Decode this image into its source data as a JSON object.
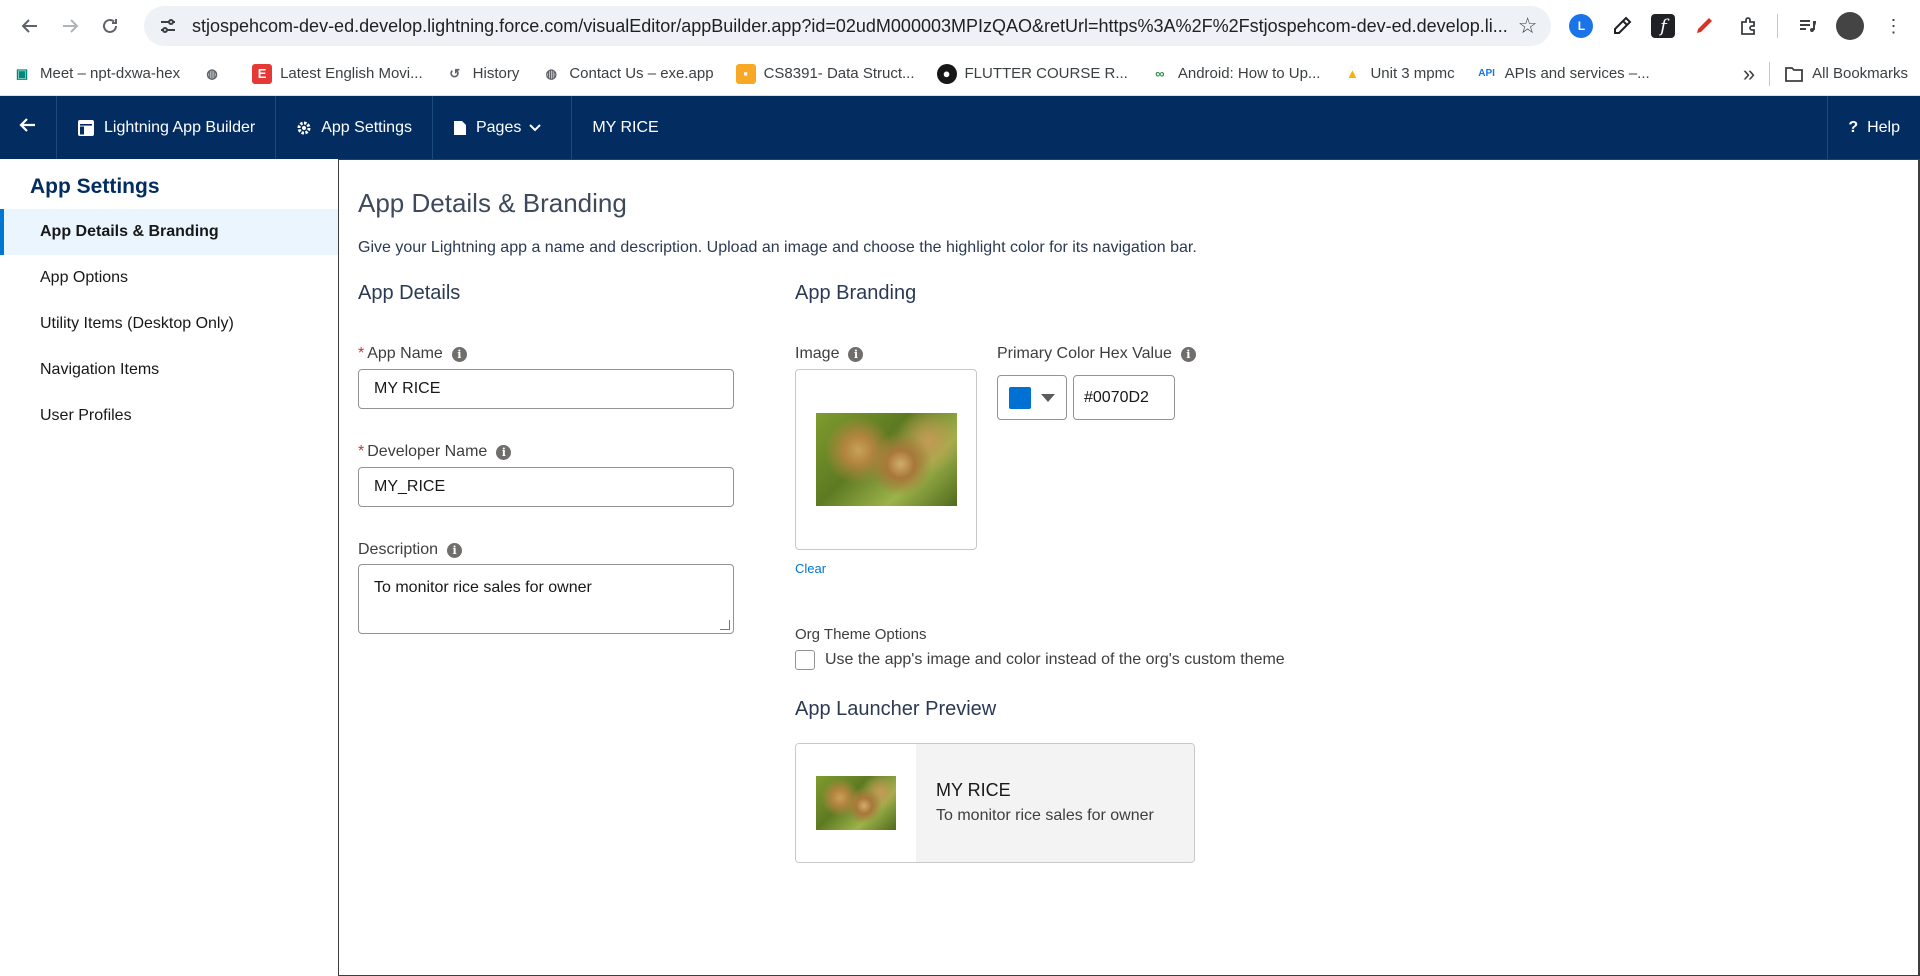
{
  "browser": {
    "url": "stjospehcom-dev-ed.develop.lightning.force.com/visualEditor/appBuilder.app?id=02udM000003MPIzQAO&retUrl=https%3A%2F%2Fstjospehcom-dev-ed.develop.li...",
    "bookmarks": [
      {
        "label": "Meet – npt-dxwa-hex",
        "icon": "meet-icon",
        "color": "#00897b"
      },
      {
        "label": "",
        "icon": "globe-icon",
        "color": "#5f6368"
      },
      {
        "label": "Latest English Movi...",
        "icon": "e-icon",
        "color": "#e53935"
      },
      {
        "label": "History",
        "icon": "history-icon",
        "color": "#5f6368"
      },
      {
        "label": "Contact Us – exe.app",
        "icon": "globe-icon",
        "color": "#5f6368"
      },
      {
        "label": "CS8391- Data Struct...",
        "icon": "classroom-icon",
        "color": "#f9a825"
      },
      {
        "label": "FLUTTER COURSE R...",
        "icon": "github-icon",
        "color": "#181717"
      },
      {
        "label": "Android: How to Up...",
        "icon": "gfg-icon",
        "color": "#2f8d46"
      },
      {
        "label": "Unit 3 mpmc",
        "icon": "drive-icon",
        "color": "#f4b400"
      },
      {
        "label": "APIs and services –...",
        "icon": "api-icon",
        "color": "#1a73e8"
      }
    ],
    "more_label": "»",
    "all_bookmarks": "All Bookmarks"
  },
  "header": {
    "builder_label": "Lightning App Builder",
    "settings_label": "App Settings",
    "pages_label": "Pages",
    "app_title": "MY RICE",
    "help_label": "Help"
  },
  "sidebar": {
    "title": "App Settings",
    "items": [
      {
        "label": "App Details & Branding",
        "active": true
      },
      {
        "label": "App Options"
      },
      {
        "label": "Utility Items (Desktop Only)"
      },
      {
        "label": "Navigation Items"
      },
      {
        "label": "User Profiles"
      }
    ]
  },
  "main": {
    "title": "App Details & Branding",
    "description": "Give your Lightning app a name and description. Upload an image and choose the highlight color for its navigation bar.",
    "details": {
      "section_title": "App Details",
      "app_name_label": "App Name",
      "app_name_value": "MY RICE",
      "dev_name_label": "Developer Name",
      "dev_name_value": "MY_RICE",
      "description_label": "Description",
      "description_value": "To monitor rice sales for owner",
      "required_mark": "*"
    },
    "branding": {
      "section_title": "App Branding",
      "image_label": "Image",
      "clear_label": "Clear",
      "color_label": "Primary Color Hex Value",
      "color_value": "#0070D2",
      "org_theme_label": "Org Theme Options",
      "org_theme_checkbox": "Use the app's image and color instead of the org's custom theme",
      "preview_title": "App Launcher Preview",
      "preview_app_name": "MY RICE",
      "preview_app_desc": "To monitor rice sales for owner"
    }
  }
}
